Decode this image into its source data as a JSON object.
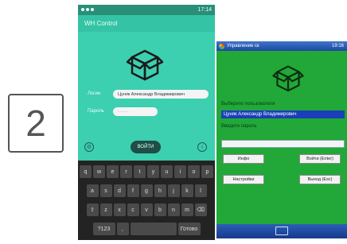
{
  "step": "2",
  "android": {
    "status_time": "17:14",
    "app_title": "WH Control",
    "login_label": "Логин",
    "login_value": "Цуняк Александр Владимирович",
    "password_label": "Пароль",
    "password_value": "·····",
    "login_button": "ВОЙТИ",
    "left_icon": "settings-icon",
    "right_icon": "info-icon",
    "keyboard": {
      "row1": [
        "q",
        "w",
        "e",
        "r",
        "t",
        "y",
        "u",
        "i",
        "o",
        "p"
      ],
      "row2": [
        "a",
        "s",
        "d",
        "f",
        "g",
        "h",
        "j",
        "k",
        "l"
      ],
      "row3": [
        "⇧",
        "z",
        "x",
        "c",
        "v",
        "b",
        "n",
        "m",
        "⌫"
      ],
      "row4": [
        "?123",
        ",",
        "",
        "",
        "Готово"
      ]
    }
  },
  "winmobile": {
    "status_text": "Управление ск",
    "status_time": "19:16",
    "select_user_label": "Выберите пользователя",
    "selected_user": "Цуняк Александр Владимирович",
    "password_label": "Введите пароль",
    "buttons": {
      "info": "Инфо",
      "enter": "Войти (Enter)",
      "settings": "Настройки",
      "exit": "Выход (Esc)"
    },
    "colors": {
      "background": "#21a838",
      "select": "#1b3fb8"
    }
  },
  "colors": {
    "android_bg": "#3ccfb0",
    "android_button": "#1f4e47"
  }
}
